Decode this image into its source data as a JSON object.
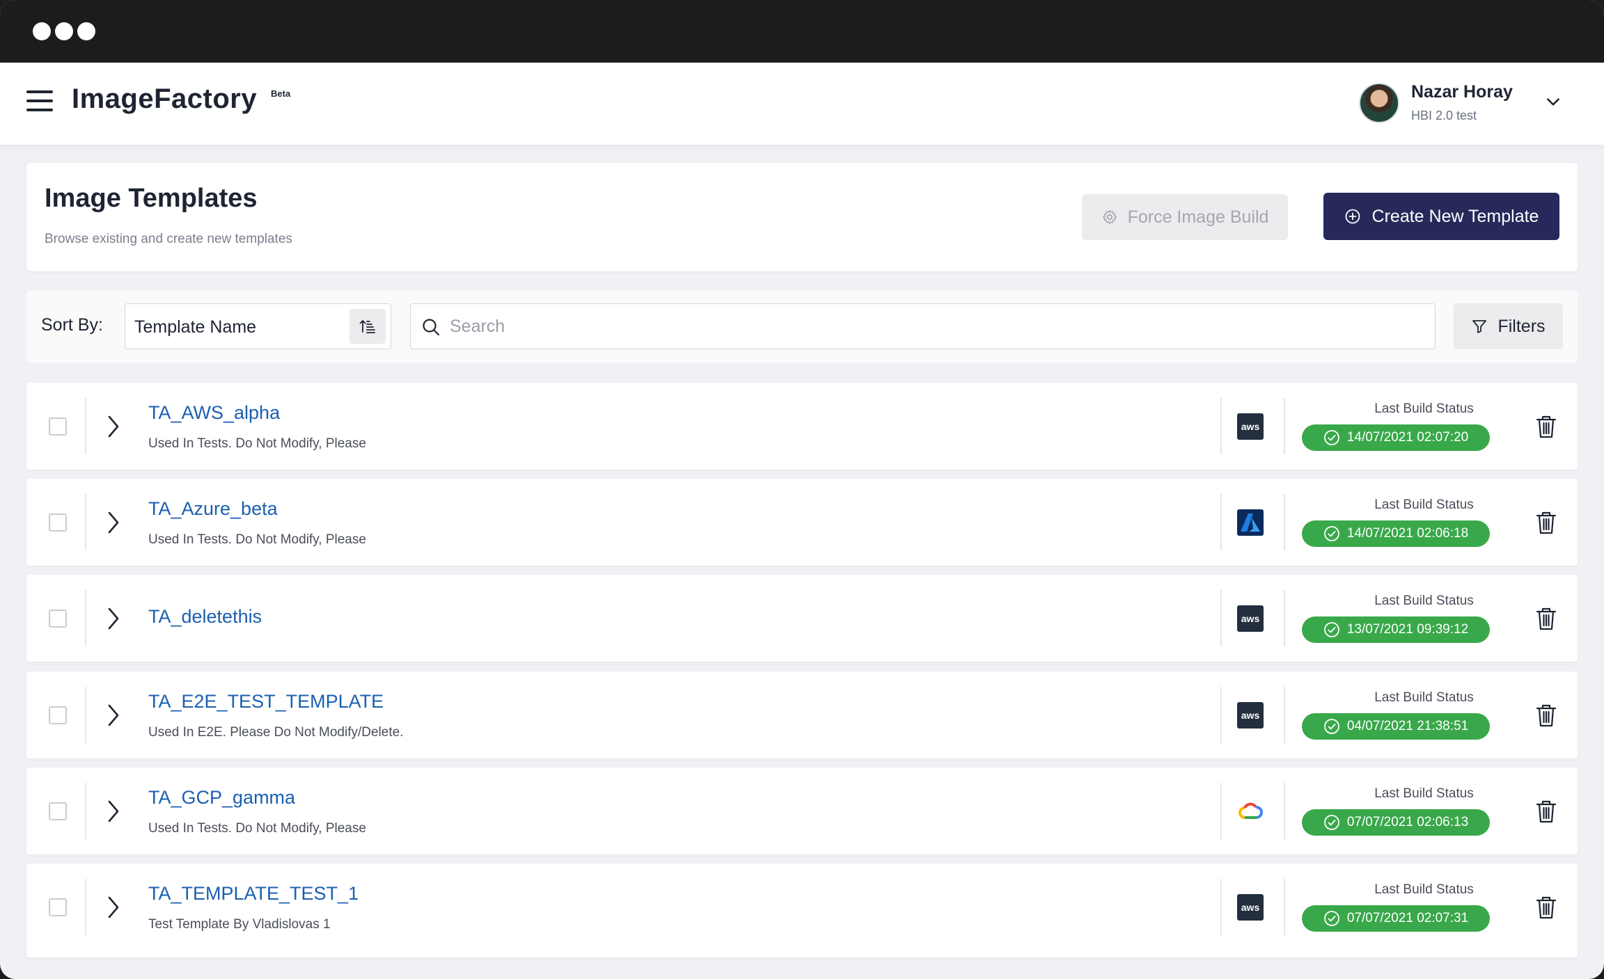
{
  "app": {
    "brand": "ImageFactory",
    "badge": "Beta"
  },
  "user": {
    "name": "Nazar Horay",
    "org": "HBI 2.0 test"
  },
  "page": {
    "title": "Image Templates",
    "subtitle": "Browse existing and create new templates",
    "force_build_label": "Force Image Build",
    "create_label": "Create New Template"
  },
  "toolbar": {
    "sort_label": "Sort By:",
    "sort_value": "Template Name",
    "search_placeholder": "Search",
    "filters_label": "Filters"
  },
  "templates": [
    {
      "name": "TA_AWS_alpha",
      "description": "Used In Tests. Do Not Modify, Please",
      "provider": "aws",
      "provider_text": "aws",
      "status_label": "Last Build Status",
      "last_build": "14/07/2021 02:07:20"
    },
    {
      "name": "TA_Azure_beta",
      "description": "Used In Tests. Do Not Modify, Please",
      "provider": "azure",
      "provider_text": "",
      "status_label": "Last Build Status",
      "last_build": "14/07/2021 02:06:18"
    },
    {
      "name": "TA_deletethis",
      "description": "",
      "provider": "aws",
      "provider_text": "aws",
      "status_label": "Last Build Status",
      "last_build": "13/07/2021 09:39:12"
    },
    {
      "name": "TA_E2E_TEST_TEMPLATE",
      "description": "Used In E2E. Please Do Not Modify/Delete.",
      "provider": "aws",
      "provider_text": "aws",
      "status_label": "Last Build Status",
      "last_build": "04/07/2021 21:38:51"
    },
    {
      "name": "TA_GCP_gamma",
      "description": "Used In Tests. Do Not Modify, Please",
      "provider": "gcp",
      "provider_text": "",
      "status_label": "Last Build Status",
      "last_build": "07/07/2021 02:06:13"
    },
    {
      "name": "TA_TEMPLATE_TEST_1",
      "description": "Test Template By Vladislovas 1",
      "provider": "aws",
      "provider_text": "aws",
      "status_label": "Last Build Status",
      "last_build": "07/07/2021 02:07:31"
    }
  ],
  "colors": {
    "primary": "#26295a",
    "link": "#1b5fb0",
    "success": "#39a84a",
    "aws_bg": "#232f3e",
    "azure": "#0a6fd1"
  }
}
